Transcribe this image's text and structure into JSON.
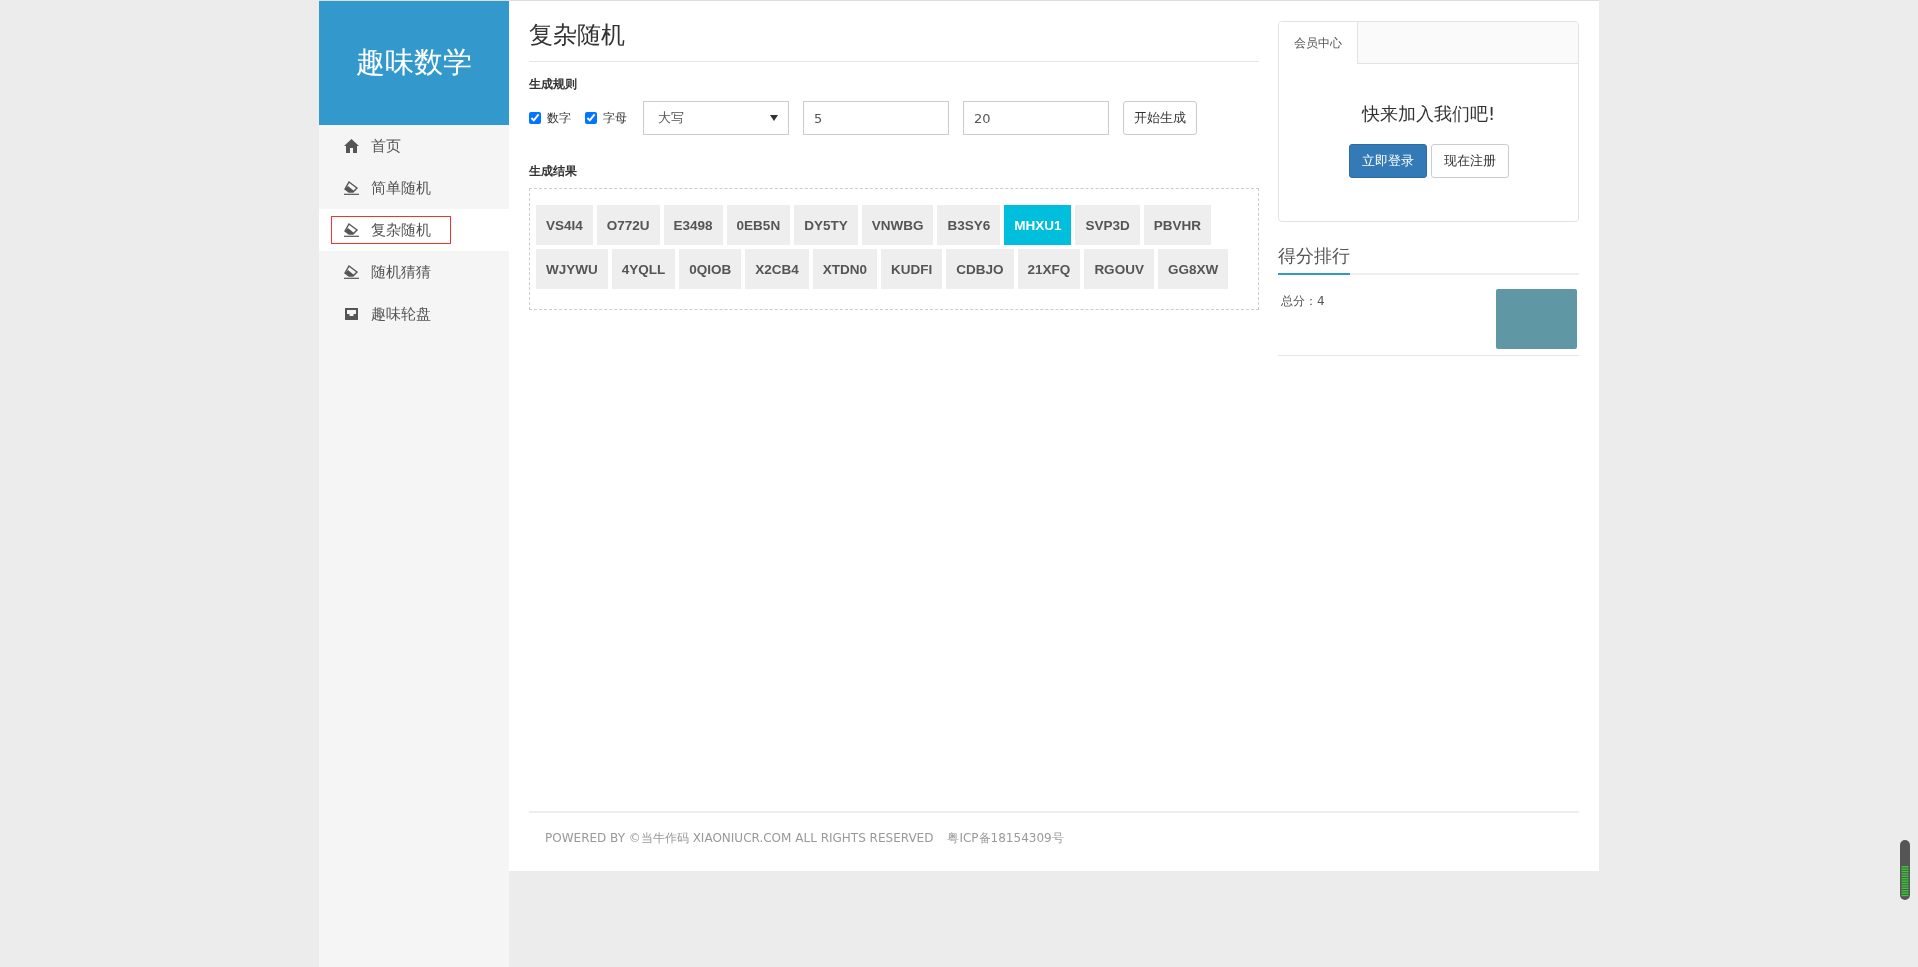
{
  "sidebar": {
    "logo": "趣味数学",
    "items": [
      {
        "label": "首页",
        "kind": "home",
        "selected": false
      },
      {
        "label": "简单随机",
        "kind": "random",
        "selected": false
      },
      {
        "label": "复杂随机",
        "kind": "random",
        "selected": true
      },
      {
        "label": "随机猜猜",
        "kind": "random",
        "selected": false
      },
      {
        "label": "趣味轮盘",
        "kind": "wheel",
        "selected": false
      }
    ]
  },
  "main": {
    "title": "复杂随机",
    "rules": {
      "heading": "生成规则",
      "checkboxes": [
        {
          "label": "数字",
          "checked": true
        },
        {
          "label": "字母",
          "checked": true
        }
      ],
      "select": {
        "value": "大写"
      },
      "inputs": [
        {
          "value": "5"
        },
        {
          "value": "20"
        }
      ],
      "button": "开始生成"
    },
    "results": {
      "heading": "生成结果",
      "chips": [
        {
          "text": "VS4I4",
          "selected": false
        },
        {
          "text": "O772U",
          "selected": false
        },
        {
          "text": "E3498",
          "selected": false
        },
        {
          "text": "0EB5N",
          "selected": false
        },
        {
          "text": "DY5TY",
          "selected": false
        },
        {
          "text": "VNWBG",
          "selected": false
        },
        {
          "text": "B3SY6",
          "selected": false
        },
        {
          "text": "MHXU1",
          "selected": true
        },
        {
          "text": "SVP3D",
          "selected": false
        },
        {
          "text": "PBVHR",
          "selected": false
        },
        {
          "text": "WJYWU",
          "selected": false
        },
        {
          "text": "4YQLL",
          "selected": false
        },
        {
          "text": "0QIOB",
          "selected": false
        },
        {
          "text": "X2CB4",
          "selected": false
        },
        {
          "text": "XTDN0",
          "selected": false
        },
        {
          "text": "KUDFI",
          "selected": false
        },
        {
          "text": "CDBJO",
          "selected": false
        },
        {
          "text": "21XFQ",
          "selected": false
        },
        {
          "text": "RGOUV",
          "selected": false
        },
        {
          "text": "GG8XW",
          "selected": false
        }
      ]
    }
  },
  "member": {
    "tabs": [
      {
        "label": "会员中心",
        "selected": true
      }
    ],
    "message": "快来加入我们吧!",
    "login": "立即登录",
    "register": "现在注册"
  },
  "ranking": {
    "title": "得分排行",
    "rows": [
      {
        "score": "总分：4"
      }
    ]
  },
  "footer": {
    "copyright": "POWERED BY ©当牛作码 XIAONIUCR.COM ALL RIGHTS RESERVED",
    "icp": "粤ICP备18154309号"
  }
}
